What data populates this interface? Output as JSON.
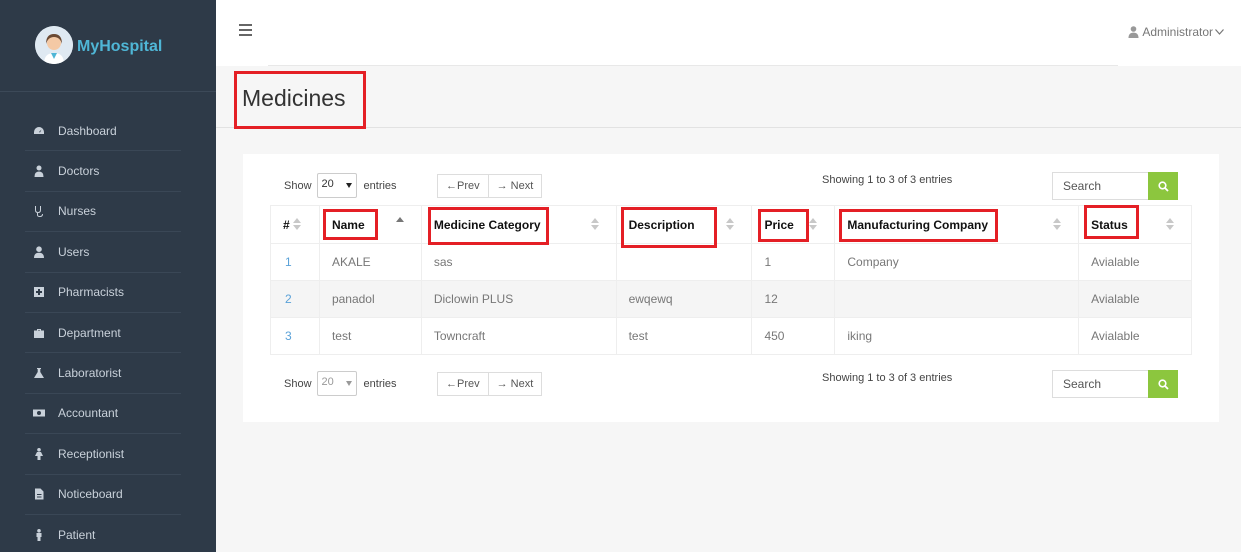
{
  "brand": {
    "name": "MyHospital"
  },
  "sidebar": {
    "items": [
      {
        "label": "Dashboard",
        "icon": "dashboard-icon"
      },
      {
        "label": "Doctors",
        "icon": "doctor-icon"
      },
      {
        "label": "Nurses",
        "icon": "stethoscope-icon"
      },
      {
        "label": "Users",
        "icon": "user-icon"
      },
      {
        "label": "Pharmacists",
        "icon": "plus-square-icon"
      },
      {
        "label": "Department",
        "icon": "briefcase-icon"
      },
      {
        "label": "Laboratorist",
        "icon": "flask-icon"
      },
      {
        "label": "Accountant",
        "icon": "money-icon"
      },
      {
        "label": "Receptionist",
        "icon": "female-icon"
      },
      {
        "label": "Noticeboard",
        "icon": "file-icon"
      },
      {
        "label": "Patient",
        "icon": "male-icon"
      }
    ]
  },
  "header": {
    "user": "Administrator"
  },
  "page": {
    "title": "Medicines"
  },
  "controls": {
    "show_label": "Show",
    "entries_label": "entries",
    "page_size": "20",
    "prev_label": "←Prev",
    "next_label": "→ Next",
    "showing_text": "Showing 1 to 3 of 3 entries",
    "search_placeholder": "Search"
  },
  "table": {
    "columns": [
      "#",
      "Name",
      "Medicine Category",
      "Description",
      "Price",
      "Manufacturing Company",
      "Status"
    ],
    "rows": [
      [
        "1",
        "AKALE",
        "sas",
        "",
        "1",
        "Company",
        "Avialable"
      ],
      [
        "2",
        "panadol",
        "Diclowin PLUS",
        "ewqewq",
        "12",
        "",
        "Avialable"
      ],
      [
        "3",
        "test",
        "Towncraft",
        "test",
        "450",
        "iking",
        "Avialable"
      ]
    ]
  },
  "colors": {
    "sidebar": "#2e3a48",
    "accent": "#8cc63e",
    "highlight": "#e41f25",
    "brand": "#4fb6d6"
  }
}
